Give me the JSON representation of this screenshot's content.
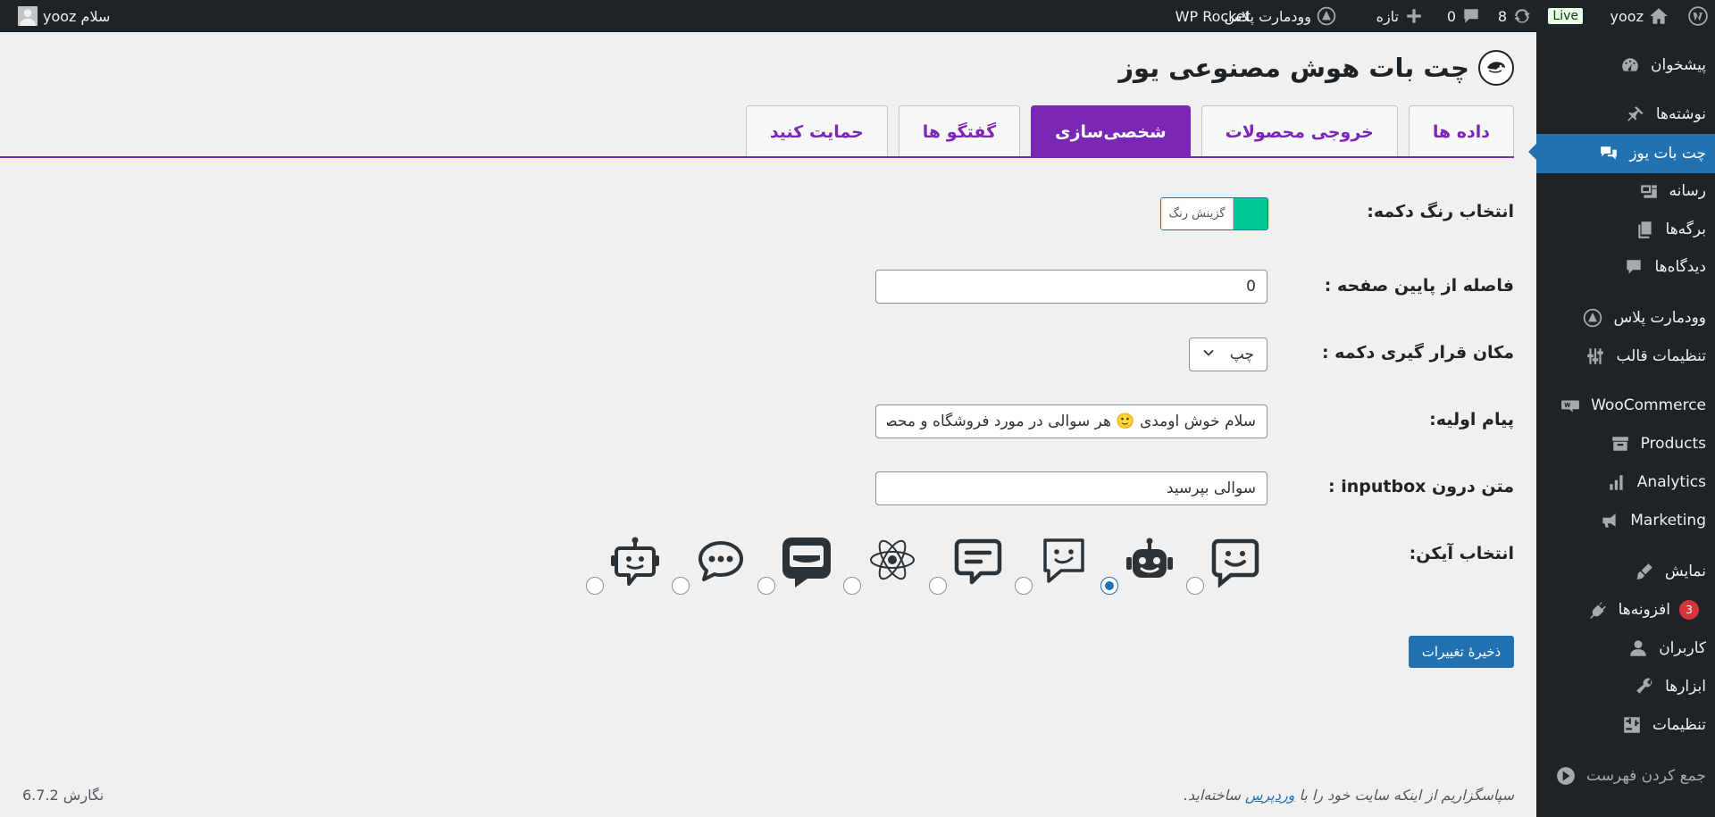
{
  "admin_bar": {
    "site_name": "yooz",
    "live_badge": "Live",
    "updates_count": "8",
    "comments_count": "0",
    "new_label": "تازه",
    "woodmart_label": "وودمارت پلاس",
    "wp_rocket_label": "WP Rocket",
    "greeting": "سلام yooz"
  },
  "sidebar": {
    "items": [
      {
        "label": "پیشخوان",
        "icon": "dashboard-icon"
      },
      {
        "label": "نوشته‌ها",
        "icon": "pin-icon"
      },
      {
        "label": "چت بات یوز",
        "icon": "chat-icon"
      },
      {
        "label": "رسانه",
        "icon": "media-icon"
      },
      {
        "label": "برگه‌ها",
        "icon": "pages-icon"
      },
      {
        "label": "دیدگاه‌ها",
        "icon": "comment-icon"
      },
      {
        "label": "وودمارت پلاس",
        "icon": "woodmart-icon"
      },
      {
        "label": "تنظیمات قالب",
        "icon": "sliders-icon"
      },
      {
        "label": "WooCommerce",
        "icon": "woo-icon"
      },
      {
        "label": "Products",
        "icon": "archive-icon"
      },
      {
        "label": "Analytics",
        "icon": "bar-chart-icon"
      },
      {
        "label": "Marketing",
        "icon": "megaphone-icon"
      },
      {
        "label": "نمایش",
        "icon": "brush-icon"
      },
      {
        "label": "افزونه‌ها",
        "icon": "plugin-icon",
        "badge": "3"
      },
      {
        "label": "کاربران",
        "icon": "user-icon"
      },
      {
        "label": "ابزارها",
        "icon": "wrench-icon"
      },
      {
        "label": "تنظیمات",
        "icon": "settings-icon"
      },
      {
        "label": "جمع کردن فهرست",
        "icon": "collapse-icon"
      }
    ]
  },
  "page": {
    "title": "چت بات هوش مصنوعی یوز",
    "tabs": [
      {
        "label": "داده ها"
      },
      {
        "label": "خروجی محصولات"
      },
      {
        "label": "شخصی‌سازی"
      },
      {
        "label": "گفتگو ها"
      },
      {
        "label": "حمایت کنید"
      }
    ]
  },
  "form": {
    "button_color_label": "انتخاب رنگ دکمه:",
    "color_value": "#00c896",
    "color_pick_label": "گزینش رنگ",
    "bottom_distance_label": "فاصله از پایین صفحه :",
    "bottom_distance_value": "0",
    "button_position_label": "مکان قرار گیری دکمه :",
    "button_position_value": "چپ",
    "initial_message_label": "پیام اولیه:",
    "initial_message_value": "سلام خوش اومدی 🙂 هر سوالی در مورد فروشگاه و محصولات داری بپرس",
    "inputbox_text_label": "متن درون inputbox :",
    "inputbox_text_value": "سوالی بپرسید",
    "icon_choice_label": "انتخاب آیکن:",
    "icon_options": [
      {
        "icon": "smiley-bubble-icon",
        "checked": false
      },
      {
        "icon": "robot-icon",
        "checked": true
      },
      {
        "icon": "smiley-bubble-outline-icon",
        "checked": false
      },
      {
        "icon": "message-lines-icon",
        "checked": false
      },
      {
        "icon": "atom-icon",
        "checked": false
      },
      {
        "icon": "bold-message-icon",
        "checked": false
      },
      {
        "icon": "chat-dots-icon",
        "checked": false
      },
      {
        "icon": "robot-outline-icon",
        "checked": false
      }
    ],
    "save_label": "ذخیرهٔ تغییرات"
  },
  "footer": {
    "thanks_before": "سپاسگزاریم از اینکه سایت خود را با",
    "thanks_link": "وردپرس",
    "thanks_after": "ساخته‌اید.",
    "version": "نگارش 6.7.2"
  }
}
